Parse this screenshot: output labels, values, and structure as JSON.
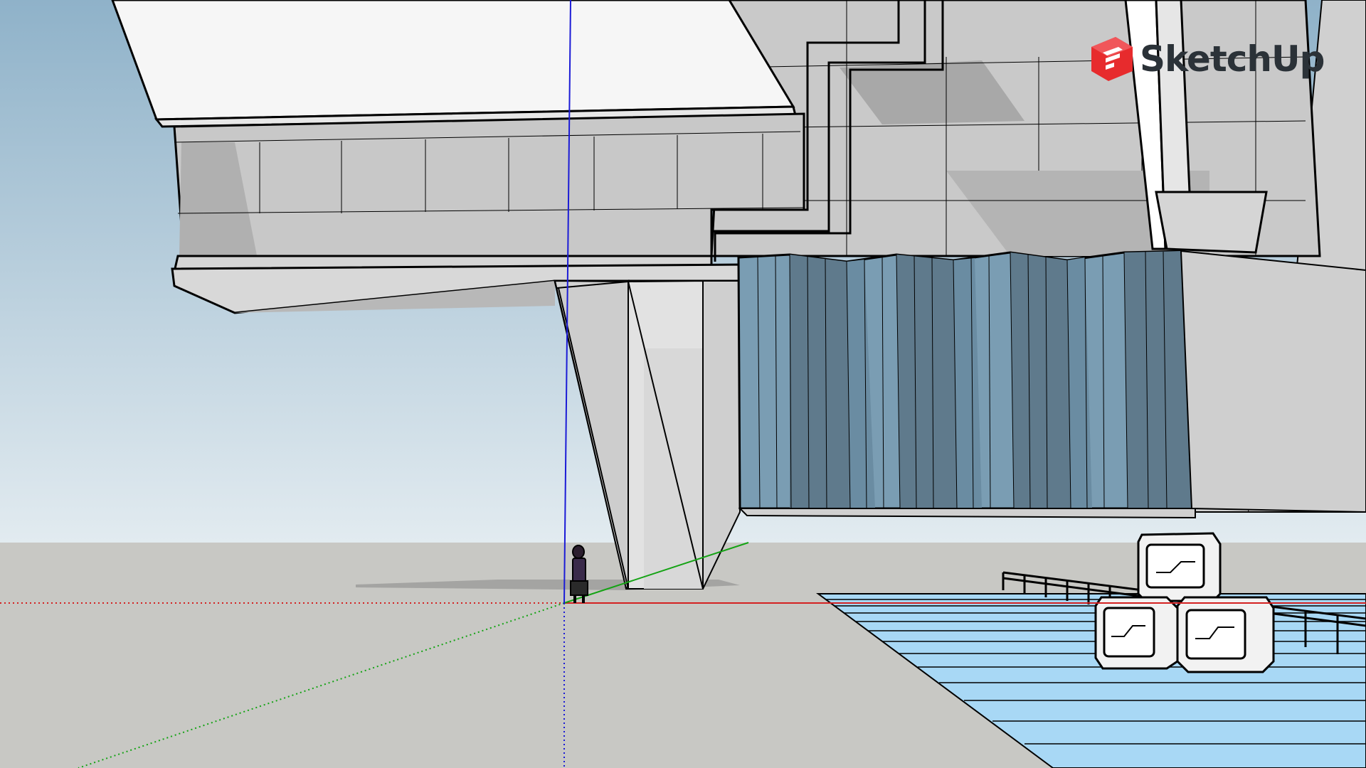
{
  "app": {
    "brand_name": "SketchUp",
    "brand_icon": "sketchup-logo-icon",
    "brand_color": "#e72b2d"
  },
  "model": {
    "description_visible": false,
    "axes": {
      "x_color": "#d42121",
      "y_color": "#14a314",
      "z_color": "#1b1bd6"
    },
    "sky_top_color": "#8fb2c9",
    "sky_bottom_color": "#e2ebf0",
    "ground_color": "#c8c8c4",
    "water_color": "#a8d8f5",
    "glass_color": "#7a9db3",
    "figure": "scale-figure-person"
  }
}
